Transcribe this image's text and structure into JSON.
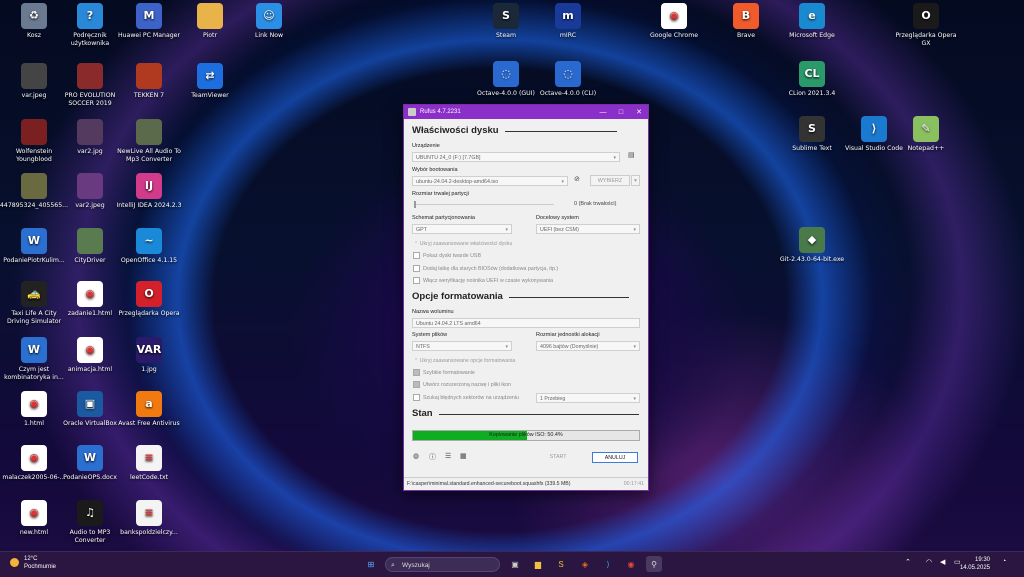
{
  "desktop": {
    "icons": [
      {
        "name": "recycle-bin",
        "label": "Kosz",
        "col": "#6b7a90",
        "glyph": "♻"
      },
      {
        "name": "manual",
        "label": "Podręcznik użytkownika",
        "col": "#2a88d8",
        "glyph": "?"
      },
      {
        "name": "huawei-pc-manager",
        "label": "Huawei PC Manager",
        "col": "#3d63c9",
        "glyph": "M"
      },
      {
        "name": "folder-piotr",
        "label": "Piotr",
        "col": "#e8b44a",
        "glyph": ""
      },
      {
        "name": "link-now",
        "label": "Link Now",
        "col": "#2b8fe6",
        "glyph": "☺"
      },
      {
        "name": "var-jpeg",
        "label": "var.jpeg",
        "col": "#444",
        "glyph": ""
      },
      {
        "name": "pes-2019",
        "label": "PRO EVOLUTION SOCCER 2019",
        "col": "#8a2a2a",
        "glyph": ""
      },
      {
        "name": "tekken-7",
        "label": "TEKKEN 7",
        "col": "#b03a20",
        "glyph": ""
      },
      {
        "name": "teamviewer",
        "label": "TeamViewer",
        "col": "#1d6fe0",
        "glyph": "⇄"
      },
      {
        "name": "wolfenstein",
        "label": "Wolfenstein Youngblood",
        "col": "#7a2020",
        "glyph": ""
      },
      {
        "name": "var2-jpg",
        "label": "var2.jpg",
        "col": "#553a60",
        "glyph": ""
      },
      {
        "name": "newlive-converter",
        "label": "NewLive All Audio To Mp3 Converter",
        "col": "#5a6a4a",
        "glyph": ""
      },
      {
        "name": "image-447895324",
        "label": "447895324_405565...",
        "col": "#6a6a40",
        "glyph": ""
      },
      {
        "name": "var2-jpeg",
        "label": "var2.jpeg",
        "col": "#6a3a80",
        "glyph": ""
      },
      {
        "name": "intellij-idea",
        "label": "IntelliJ IDEA 2024.2.3",
        "col": "#d23a8a",
        "glyph": "IJ"
      },
      {
        "name": "word-doc-1",
        "label": "PodaniePiotrKulim...",
        "col": "#2b6fd0",
        "glyph": "W"
      },
      {
        "name": "city-driver",
        "label": "CityDriver",
        "col": "#5a7a50",
        "glyph": ""
      },
      {
        "name": "openoffice",
        "label": "OpenOffice 4.1.15",
        "col": "#1a8ad8",
        "glyph": "~"
      },
      {
        "name": "taxi-life",
        "label": "Taxi Life A City Driving Simulator",
        "col": "#222",
        "glyph": "🚕"
      },
      {
        "name": "zadanie1-html",
        "label": "zadanie1.html",
        "col": "#fff",
        "glyph": "◉"
      },
      {
        "name": "opera-browser",
        "label": "Przeglądarka Opera",
        "col": "#d4202a",
        "glyph": "O"
      },
      {
        "name": "word-doc-2",
        "label": "Czym jest kombinatoryka in...",
        "col": "#2b6fd0",
        "glyph": "W"
      },
      {
        "name": "animacja-html",
        "label": "animacja.html",
        "col": "#fff",
        "glyph": "◉"
      },
      {
        "name": "file-1jpg",
        "label": "1.jpg",
        "col": "#2a1a6a",
        "glyph": "VAR"
      },
      {
        "name": "file-1html",
        "label": "1.html",
        "col": "#fff",
        "glyph": "◉"
      },
      {
        "name": "virtualbox",
        "label": "Oracle VirtualBox",
        "col": "#1a5aa0",
        "glyph": "▣"
      },
      {
        "name": "avast",
        "label": "Avast Free Antivirus",
        "col": "#f07a10",
        "glyph": "a"
      },
      {
        "name": "malaczek-html",
        "label": "malaczek2005-06-...",
        "col": "#fff",
        "glyph": "◉"
      },
      {
        "name": "word-doc-3",
        "label": "PodanieOPS.docx",
        "col": "#2b6fd0",
        "glyph": "W"
      },
      {
        "name": "leetcode-txt",
        "label": "leetCode.txt",
        "col": "#f4f4f4",
        "glyph": "≡"
      },
      {
        "name": "new-html",
        "label": "new.html",
        "col": "#fff",
        "glyph": "◉"
      },
      {
        "name": "audio-to-mp3",
        "label": "Audio to MP3 Converter",
        "col": "#1a1a1a",
        "glyph": "♫"
      },
      {
        "name": "bankspoldzielczy-txt",
        "label": "bankspoldzielczy...",
        "col": "#f4f4f4",
        "glyph": "≡"
      },
      {
        "name": "steam",
        "label": "Steam",
        "col": "#1b2838",
        "glyph": "S"
      },
      {
        "name": "mirc",
        "label": "mIRC",
        "col": "#1a3a9a",
        "glyph": "m"
      },
      {
        "name": "octave-gui",
        "label": "Octave-4.0.0 (GUI)",
        "col": "#2a6ad0",
        "glyph": "◌"
      },
      {
        "name": "octave-cli",
        "label": "Octave-4.0.0 (CLI)",
        "col": "#2a6ad0",
        "glyph": "◌"
      },
      {
        "name": "google-chrome",
        "label": "Google Chrome",
        "col": "#fff",
        "glyph": "◉"
      },
      {
        "name": "brave",
        "label": "Brave",
        "col": "#f15a2a",
        "glyph": "B"
      },
      {
        "name": "microsoft-edge",
        "label": "Microsoft Edge",
        "col": "#1a8ad0",
        "glyph": "e"
      },
      {
        "name": "opera-gx",
        "label": "Przeglądarka Opera GX",
        "col": "#1a1a1a",
        "glyph": "O"
      },
      {
        "name": "clion",
        "label": "CLion 2021.3.4",
        "col": "#2a9a6a",
        "glyph": "CL"
      },
      {
        "name": "sublime-text",
        "label": "Sublime Text",
        "col": "#333",
        "glyph": "S"
      },
      {
        "name": "visual-studio-code",
        "label": "Visual Studio Code",
        "col": "#1a7ad0",
        "glyph": "⟩"
      },
      {
        "name": "notepad-plus-plus",
        "label": "Notepad++",
        "col": "#8ac060",
        "glyph": "✎"
      },
      {
        "name": "git-installer",
        "label": "Git-2.43.0-64-bit.exe",
        "col": "#4a7a4a",
        "glyph": "◆"
      }
    ]
  },
  "rufus": {
    "title": "Rufus 4.7.2231",
    "window_controls": {
      "min": "—",
      "max": "□",
      "close": "✕"
    },
    "drive_section": "Właściwości dysku",
    "device_label": "Urządzenie",
    "device_value": "UBUNTU 24_0 (F:) [7.7GB]",
    "boot_label": "Wybór bootowania",
    "boot_value": "ubuntu-24.04.2-desktop-amd64.iso",
    "select_button": "WYBIERZ",
    "persistent_label": "Rozmiar trwałej partycji",
    "persistent_value": "0 (Brak trwałości)",
    "scheme_label": "Schemat partycjonowania",
    "scheme_value": "GPT",
    "target_label": "Docelowy system",
    "target_value": "UEFI (bez CSM)",
    "hide_adv_drive": "Ukryj zaawansowane właściwości dysku",
    "opt_show_usb": "Pokaż dyski twarde USB",
    "opt_bios_fixes": "Dodaj łatkę dla starych BIOSów (dodatkowa partycja, itp.)",
    "opt_uefi_verify": "Włącz weryfikację nośnika UEFI w czasie wykonywania",
    "format_section": "Opcje formatowania",
    "volume_label": "Nazwa woluminu",
    "volume_value": "Ubuntu 24.04.2 LTS amd64",
    "fs_label": "System plików",
    "fs_value": "NTFS",
    "cluster_label": "Rozmiar jednostki alokacji",
    "cluster_value": "4096 bajtów (Domyślnie)",
    "hide_adv_format": "Ukryj zaawansowane opcje formatowania",
    "opt_quick_format": "Szybkie formatowanie",
    "opt_ext_label": "Utwórz rozszerzoną nazwę i pliki ikon",
    "opt_bad_blocks": "Szukaj błędnych sektorów na urządzeniu",
    "passes_value": "1 Przebieg",
    "status_section": "Stan",
    "progress_text": "Kopiowanie plików ISO: 50.4%",
    "progress_fraction": 0.504,
    "start_button": "START",
    "cancel_button": "ANULUJ",
    "status_path": "F:\\casper\\minimal.standard.enhanced-secureboot.squashfs (339.5 MB)",
    "elapsed": "00:17:41"
  },
  "taskbar": {
    "temperature": "12°C",
    "weather": "Pochmurnie",
    "search_placeholder": "Wyszukaj",
    "time": "19:30",
    "date": "14.05.2025"
  }
}
